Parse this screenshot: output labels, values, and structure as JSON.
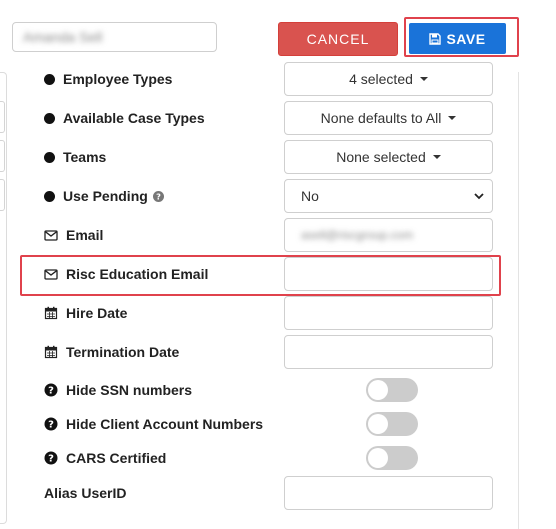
{
  "header": {
    "user_name": "Amanda Sell",
    "cancel_label": "CANCEL",
    "save_label": "SAVE"
  },
  "fields": {
    "employee_types": {
      "label": "Employee Types",
      "value": "4 selected"
    },
    "available_case_types": {
      "label": "Available Case Types",
      "value": "None defaults to All"
    },
    "teams": {
      "label": "Teams",
      "value": "None selected"
    },
    "use_pending": {
      "label": "Use Pending",
      "value": "No"
    },
    "email": {
      "label": "Email",
      "value": "asell@riscgroup.com"
    },
    "risc_education_email": {
      "label": "Risc Education Email",
      "value": ""
    },
    "hire_date": {
      "label": "Hire Date",
      "value": ""
    },
    "termination_date": {
      "label": "Termination Date",
      "value": ""
    },
    "hide_ssn": {
      "label": "Hide SSN numbers",
      "enabled": false
    },
    "hide_client_account_numbers": {
      "label": "Hide Client Account Numbers",
      "enabled": false
    },
    "cars_certified": {
      "label": "CARS Certified",
      "enabled": false
    },
    "alias_userid": {
      "label": "Alias UserID",
      "value": ""
    }
  },
  "colors": {
    "cancel": "#d9534f",
    "save": "#1a73d9",
    "highlight": "#e0424c",
    "toggle_off": "#cccccc"
  },
  "icons": {
    "save": "floppy-disk-icon",
    "bullet": "circle-icon",
    "email": "envelope-icon",
    "date": "calendar-icon",
    "help": "question-circle-icon",
    "dropdown": "caret-down-icon"
  }
}
